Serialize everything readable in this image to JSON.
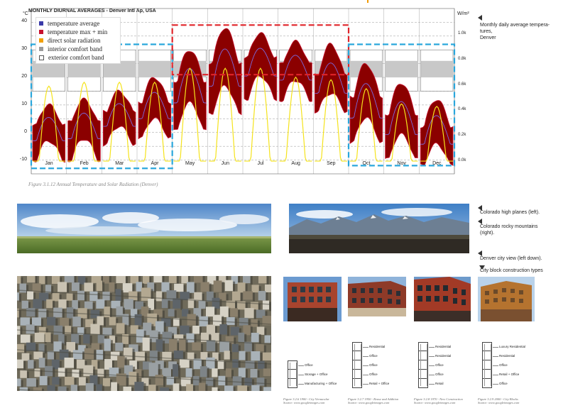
{
  "chart": {
    "title": "MONTHLY DIURNAL AVERAGES - Denver Intl Ap, USA",
    "left_unit": "°C",
    "right_unit": "W/m²",
    "y_ticks": [
      "40",
      "30",
      "20",
      "10",
      "0",
      "-10"
    ],
    "y2_ticks": [
      "1.0k",
      "0.8k",
      "0.6k",
      "0.4k",
      "0.2k",
      "0.0k"
    ],
    "months": [
      "Jan",
      "Feb",
      "Mar",
      "Apr",
      "May",
      "Jun",
      "Jul",
      "Aug",
      "Sep",
      "Oct",
      "Nov",
      "Dec"
    ],
    "legend": [
      {
        "label": "temperature average",
        "color": "#3a3aa8"
      },
      {
        "label": "temperature max + min",
        "color": "#c8102e"
      },
      {
        "label": "direct solar radiation",
        "color": "#f2a000"
      },
      {
        "label": "interior comfort band",
        "color": "#9a9a9a"
      },
      {
        "label": "exterior comfort band",
        "color": "#ffffff"
      }
    ],
    "caption": "Figure 3.1.12  Annual Temperature and Solar Radiation (Denver)",
    "colors": {
      "cold_box": "#2aa7dc",
      "warm_box": "#e0242a",
      "band": "#8b0000",
      "solar": "#f5e31c"
    }
  },
  "chart_data": {
    "type": "area",
    "title": "MONTHLY DIURNAL AVERAGES - Denver Intl Ap, USA",
    "categories": [
      "Jan",
      "Feb",
      "Mar",
      "Apr",
      "May",
      "Jun",
      "Jul",
      "Aug",
      "Sep",
      "Oct",
      "Nov",
      "Dec"
    ],
    "ylabel": "°C",
    "y2label": "W/m²",
    "ylim": [
      -15,
      45
    ],
    "y2lim": [
      -0.1,
      1.2
    ],
    "series": [
      {
        "name": "temperature max + min",
        "max": [
          10,
          12,
          15,
          20,
          30,
          38,
          36,
          33,
          32,
          25,
          18,
          12
        ],
        "min": [
          -12,
          -12,
          -6,
          -4,
          -2,
          4,
          10,
          10,
          6,
          -6,
          -12,
          -14
        ]
      },
      {
        "name": "temperature average",
        "values": [
          0,
          1,
          5,
          8,
          15,
          21,
          24,
          22,
          17,
          9,
          3,
          -1
        ]
      },
      {
        "name": "direct solar radiation",
        "values": [
          0.59,
          0.62,
          0.62,
          0.62,
          0.73,
          0.73,
          0.73,
          0.66,
          0.64,
          0.57,
          0.45,
          0.43
        ]
      }
    ],
    "annotations": [
      {
        "label": "interior comfort band",
        "range": [
          20,
          26
        ]
      },
      {
        "label": "exterior comfort band",
        "range": [
          15,
          30
        ]
      }
    ]
  },
  "side_notes": {
    "chart_note": [
      "Monthly daily average tempera-",
      "tures,",
      "Denver"
    ],
    "photo_note_1": "Colorado high planes (left).",
    "photo_note_2a": "Colorado          rocky          mountains",
    "photo_note_2b": "(right).",
    "photo_note_3": "Denver city view (left down).",
    "photo_note_4": "City block construction types"
  },
  "buildings": [
    {
      "floors": [
        "Office",
        "Storage + Office",
        "Manufacturing + Office"
      ],
      "caption1": "Figure 3.2.6  1900 - City Vernacular",
      "caption2": "Source: www.googleimages.com"
    },
    {
      "floors": [
        "Residential",
        "Office",
        "Office",
        "Office",
        "Retail + Office"
      ],
      "caption1": "Figure 3.2.7  1950 - Reuse and Addition",
      "caption2": "Source: www.googleimages.com"
    },
    {
      "floors": [
        "Residential",
        "Residential",
        "Office",
        "Office",
        "Retail"
      ],
      "caption1": "Figure 3.2.8  1970 - New Construction",
      "caption2": "Source: www.googleimages.com"
    },
    {
      "floors": [
        "Luxury Residential",
        "Residential",
        "Office",
        "Retail + Office",
        "Office"
      ],
      "caption1": "Figure 3.2.9  2000 - City Blocks",
      "caption2": "Source: www.googleimages.com"
    }
  ]
}
